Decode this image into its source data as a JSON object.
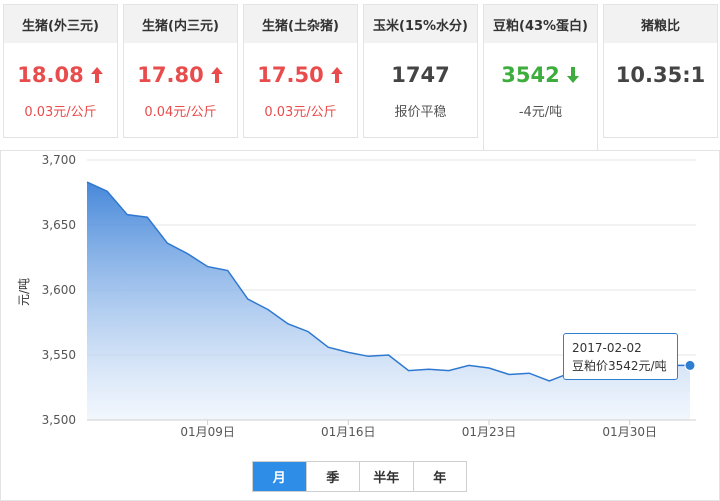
{
  "cards": [
    {
      "title": "生猪(外三元)",
      "price": "18.08",
      "trend": "up",
      "sub": "0.03元/公斤"
    },
    {
      "title": "生猪(内三元)",
      "price": "17.80",
      "trend": "up",
      "sub": "0.04元/公斤"
    },
    {
      "title": "生猪(土杂猪)",
      "price": "17.50",
      "trend": "up",
      "sub": "0.03元/公斤"
    },
    {
      "title": "玉米(15%水分)",
      "price": "1747",
      "trend": "flat",
      "sub": "报价平稳"
    },
    {
      "title": "豆粕(43%蛋白)",
      "price": "3542",
      "trend": "down",
      "sub": "-4元/吨"
    },
    {
      "title": "猪粮比",
      "price": "10.35:1",
      "trend": "none",
      "sub": ""
    }
  ],
  "colors": {
    "up": "#e84c4c",
    "down": "#3dad3d",
    "accent": "#2e8de6",
    "line": "#2f78d0"
  },
  "tooltip": {
    "date": "2017-02-02",
    "text": "豆粕价3542元/吨"
  },
  "tabs": [
    "月",
    "季",
    "半年",
    "年"
  ],
  "active_tab": "月",
  "chart_data": {
    "type": "area",
    "ylabel": "元/吨",
    "ylim": [
      3500,
      3700
    ],
    "yticks": [
      "3,700",
      "3,650",
      "3,600",
      "3,550",
      "3,500"
    ],
    "xticks": [
      "01月09日",
      "01月16日",
      "01月23日",
      "01月30日"
    ],
    "grid": true,
    "series": [
      {
        "values": [
          3683,
          3676,
          3658,
          3656,
          3636,
          3628,
          3618,
          3615,
          3593,
          3585,
          3574,
          3568,
          3556,
          3552,
          3549,
          3550,
          3538,
          3539,
          3538,
          3542,
          3540,
          3535,
          3536,
          3530,
          3536,
          3535,
          3538,
          3541,
          3542,
          3542,
          3542
        ],
        "dates": [
          "2017-01-03",
          "2017-01-04",
          "2017-01-05",
          "2017-01-06",
          "2017-01-07",
          "2017-01-08",
          "2017-01-09",
          "2017-01-10",
          "2017-01-11",
          "2017-01-12",
          "2017-01-13",
          "2017-01-14",
          "2017-01-15",
          "2017-01-16",
          "2017-01-17",
          "2017-01-18",
          "2017-01-19",
          "2017-01-20",
          "2017-01-21",
          "2017-01-22",
          "2017-01-23",
          "2017-01-24",
          "2017-01-25",
          "2017-01-26",
          "2017-01-27",
          "2017-01-28",
          "2017-01-29",
          "2017-01-30",
          "2017-01-31",
          "2017-02-01",
          "2017-02-02"
        ]
      }
    ]
  }
}
